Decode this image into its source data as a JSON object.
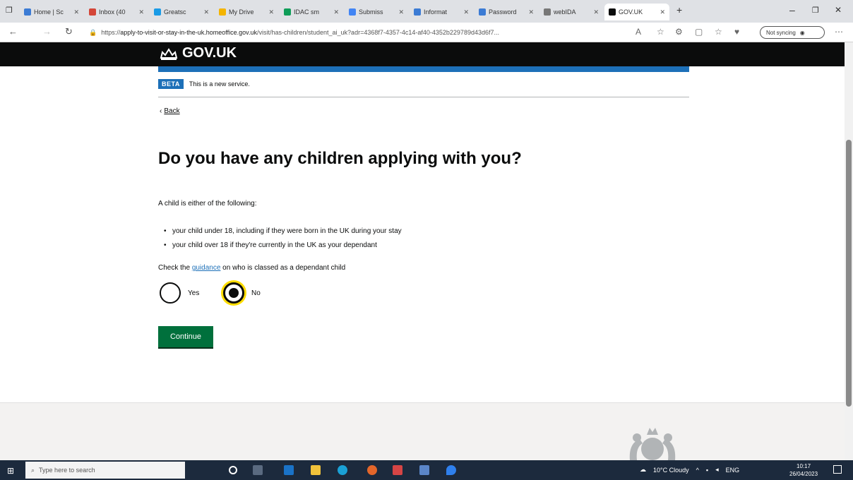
{
  "browser": {
    "tabs": [
      {
        "label": "Home | Sc",
        "fav": "#3b7bd4"
      },
      {
        "label": "Inbox (40",
        "fav": "#d44638"
      },
      {
        "label": "Greatsc",
        "fav": "#1a9be6"
      },
      {
        "label": "My Drive",
        "fav": "#f4b400"
      },
      {
        "label": "IDAC sm",
        "fav": "#0f9d58"
      },
      {
        "label": "Submiss",
        "fav": "#4285f4"
      },
      {
        "label": "Informat",
        "fav": "#3b7bd4"
      },
      {
        "label": "Password",
        "fav": "#3b7bd4"
      },
      {
        "label": "webIDA",
        "fav": "#777777"
      },
      {
        "label": "GOV.UK",
        "fav": "#0b0c0c"
      }
    ],
    "url_prefix": "https://",
    "url_host": "apply-to-visit-or-stay-in-the-uk.homeoffice.gov.uk",
    "url_path": "/visit/has-children/student_ai_uk?adr=4368f7-4357-4c14-af40-4352b229789d43d6f7...",
    "sync_label": "Not syncing"
  },
  "header": {
    "logo_text": "GOV.UK"
  },
  "beta": {
    "tag": "BETA",
    "text": "This is a new service."
  },
  "back_label": "Back",
  "question": {
    "title": "Do you have any children applying with you?",
    "lead": "A child is either of the following:",
    "bullets": [
      "your child under 18, including if they were born in the UK during your stay",
      "your child over 18 if they're currently in the UK as your dependant"
    ],
    "check_prefix": "Check the ",
    "check_link": "guidance",
    "check_suffix": " on who is classed as a dependant child",
    "options": [
      {
        "label": "Yes",
        "checked": false
      },
      {
        "label": "No",
        "checked": true
      }
    ]
  },
  "continue_label": "Continue",
  "taskbar": {
    "search_placeholder": "Type here to search",
    "weather": "10°C Cloudy",
    "lang": "ENG",
    "time": "10:17",
    "date": "26/04/2023"
  }
}
